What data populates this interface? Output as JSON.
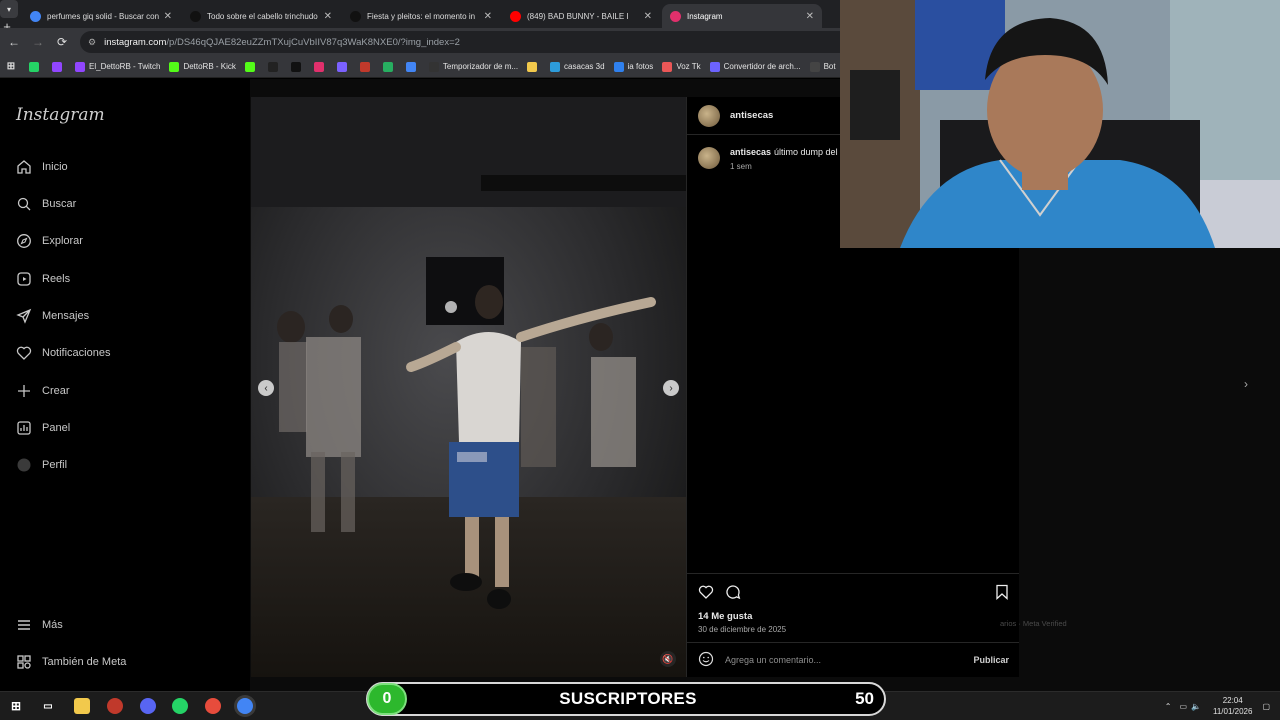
{
  "browser": {
    "tabs": [
      {
        "title": "perfumes giq solid - Buscar con",
        "favicon": "google-icon",
        "color": "#4285f4"
      },
      {
        "title": "Todo sobre el cabello trinchudo",
        "favicon": "tiktok-icon",
        "color": "#111111"
      },
      {
        "title": "Fiesta y pleitos: el momento in",
        "favicon": "tiktok-icon",
        "color": "#111111"
      },
      {
        "title": "(849) BAD BUNNY - BAILE I",
        "favicon": "youtube-icon",
        "color": "#ff0000"
      },
      {
        "title": "Instagram",
        "favicon": "instagram-icon",
        "color": "#e1306c"
      }
    ],
    "url_host": "instagram.com",
    "url_path": "/p/DS46qQJAE82euZZmTXujCuVbIIV87q3WaK8NXE0/?img_index=2",
    "bookmarks": [
      {
        "label": "",
        "icon": "whatsapp-icon",
        "color": "#25d366"
      },
      {
        "label": "",
        "icon": "twitch-icon",
        "color": "#9146ff"
      },
      {
        "label": "El_DettoRB - Twitch",
        "icon": "twitch-icon",
        "color": "#9146ff"
      },
      {
        "label": "DettoRB - Kick",
        "icon": "kick-icon",
        "color": "#53fc18"
      },
      {
        "label": "",
        "icon": "kick-icon",
        "color": "#53fc18"
      },
      {
        "label": "",
        "icon": "tiktok-icon",
        "color": "#222222"
      },
      {
        "label": "",
        "icon": "x-icon",
        "color": "#111111"
      },
      {
        "label": "",
        "icon": "instagram-icon",
        "color": "#e1306c"
      },
      {
        "label": "",
        "icon": "app-icon",
        "color": "#7b61ff"
      },
      {
        "label": "",
        "icon": "app-icon",
        "color": "#c0392b"
      },
      {
        "label": "",
        "icon": "app-icon",
        "color": "#27ae60"
      },
      {
        "label": "",
        "icon": "google-icon",
        "color": "#4285f4"
      },
      {
        "label": "Temporizador de m...",
        "icon": "timer-icon",
        "color": "#333333"
      },
      {
        "label": "",
        "icon": "folder-icon",
        "color": "#f2c94c"
      },
      {
        "label": "casacas 3d",
        "icon": "image-icon",
        "color": "#2d9cdb"
      },
      {
        "label": "ia fotos",
        "icon": "app-icon",
        "color": "#2f80ed"
      },
      {
        "label": "Voz Tk",
        "icon": "app-icon",
        "color": "#eb5757"
      },
      {
        "label": "Convertidor de arch...",
        "icon": "convert-icon",
        "color": "#6c63ff"
      },
      {
        "label": "Bot",
        "icon": "app-icon",
        "color": "#444444"
      }
    ]
  },
  "instagram": {
    "logo": "Instagram",
    "nav": [
      {
        "label": "Inicio",
        "icon": "home-icon"
      },
      {
        "label": "Buscar",
        "icon": "search-icon"
      },
      {
        "label": "Explorar",
        "icon": "explore-icon"
      },
      {
        "label": "Reels",
        "icon": "reels-icon"
      },
      {
        "label": "Mensajes",
        "icon": "messages-icon"
      },
      {
        "label": "Notificaciones",
        "icon": "heart-icon"
      },
      {
        "label": "Crear",
        "icon": "plus-icon"
      },
      {
        "label": "Panel",
        "icon": "panel-icon"
      },
      {
        "label": "Perfil",
        "icon": "profile-icon"
      }
    ],
    "more": {
      "label": "Más",
      "icon": "menu-icon"
    },
    "meta": {
      "label": "También de Meta",
      "icon": "meta-icon"
    },
    "post": {
      "username": "antisecas",
      "caption": "último dump del",
      "caption_time": "1 sem",
      "likes": "14 Me gusta",
      "date": "30 de diciembre de 2025",
      "comment_placeholder": "Agrega un comentario...",
      "publish": "Publicar"
    },
    "footer": "arios · Meta Verified"
  },
  "taskbar": {
    "time": "22:04",
    "date": "11/01/2026"
  },
  "overlay": {
    "count": "0",
    "label": "SUSCRIPTORES",
    "goal": "50"
  }
}
